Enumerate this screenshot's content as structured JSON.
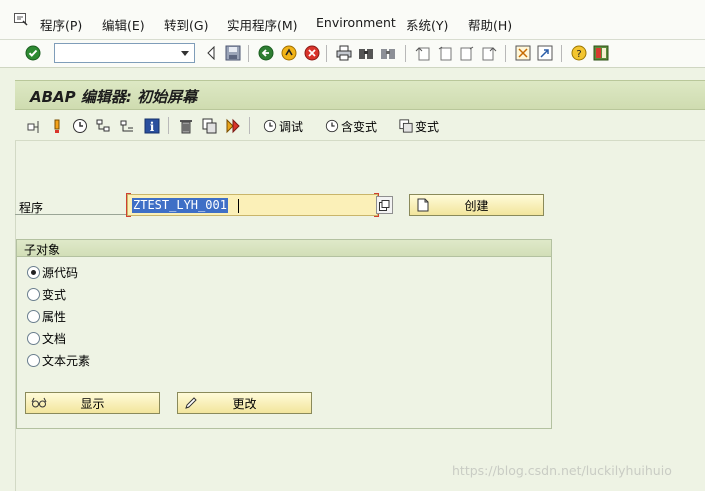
{
  "menubar": {
    "items": [
      {
        "label": "程序(P)"
      },
      {
        "label": "编辑(E)"
      },
      {
        "label": "转到(G)"
      },
      {
        "label": "实用程序(M)"
      },
      {
        "label": "Environment"
      },
      {
        "label": "系统(Y)"
      },
      {
        "label": "帮助(H)"
      }
    ]
  },
  "toolbar": {
    "command_value": ""
  },
  "screen": {
    "title": "ABAP 编辑器:  初始屏幕"
  },
  "app_toolbar": {
    "debug_label": "调试",
    "with_variant_label": "含变式",
    "variant_label": "变式"
  },
  "program": {
    "label": "程序",
    "value": "ZTEST_LYH_001",
    "create_label": "创建"
  },
  "subobjects": {
    "title": "子对象",
    "options": [
      {
        "label": "源代码",
        "selected": true
      },
      {
        "label": "变式",
        "selected": false
      },
      {
        "label": "属性",
        "selected": false
      },
      {
        "label": "文档",
        "selected": false
      },
      {
        "label": "文本元素",
        "selected": false
      }
    ],
    "display_label": "显示",
    "change_label": "更改"
  },
  "watermark": "https://blog.csdn.net/luckilyhuihuio",
  "colors": {
    "background": "#eef3e4",
    "title_bar": "#d4e0b9",
    "input_highlight": "#fbf0b8",
    "selection": "#3f6fc6",
    "button": "#f6ebb0"
  }
}
